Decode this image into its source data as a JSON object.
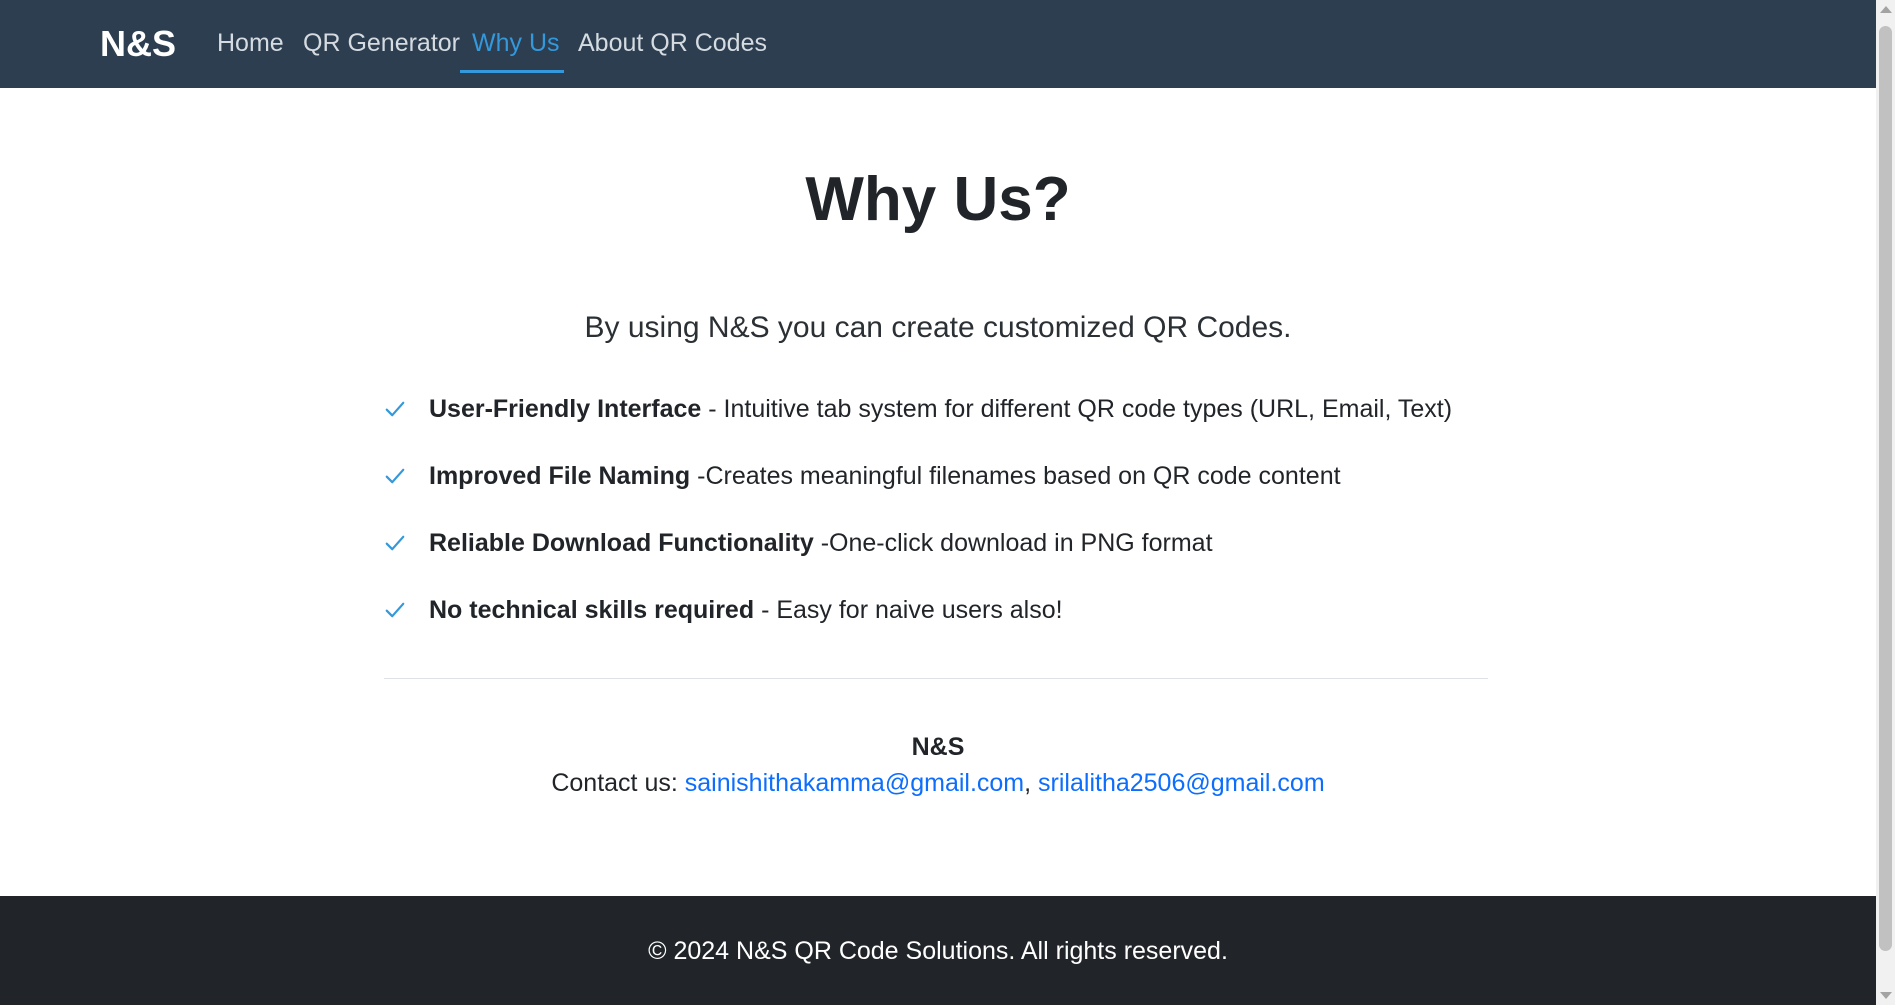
{
  "navbar": {
    "brand": "N&S",
    "items": [
      {
        "label": "Home",
        "active": false
      },
      {
        "label": "QR Generator",
        "active": false
      },
      {
        "label": "Why Us",
        "active": true
      },
      {
        "label": "About QR Codes",
        "active": false
      }
    ],
    "background_color": "#2c3e50",
    "active_color": "#3498db"
  },
  "main": {
    "title": "Why Us?",
    "lead": "By using N&S you can create customized QR Codes.",
    "features": [
      {
        "icon": "check-icon",
        "title": "User-Friendly Interface",
        "description": " - Intuitive tab system for different QR code types (URL, Email, Text)"
      },
      {
        "icon": "check-icon",
        "title": "Improved File Naming",
        "description": " -Creates meaningful filenames based on QR code content"
      },
      {
        "icon": "check-icon",
        "title": "Reliable Download Functionality",
        "description": " -One-click download in PNG format"
      },
      {
        "icon": "check-icon",
        "title": "No technical skills required",
        "description": " - Easy for naive users also!"
      }
    ],
    "check_color": "#3498db"
  },
  "contact": {
    "brand": "N&S",
    "prefix": "Contact us: ",
    "email_1": "sainishithakamma@gmail.com",
    "separator": ", ",
    "email_2": "srilalitha2506@gmail.com",
    "link_color": "#0d6efd"
  },
  "footer": {
    "text": "© 2024 N&S QR Code Solutions. All rights reserved.",
    "background_color": "#212529"
  }
}
